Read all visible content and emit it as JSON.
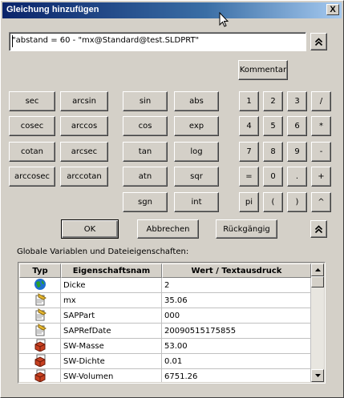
{
  "window": {
    "title": "Gleichung hinzufügen",
    "close_glyph": "X"
  },
  "equation": {
    "value": "\"abstand = 60 - \"mx@Standard@test.SLDPRT\""
  },
  "buttons": {
    "collapse_top": "⌃",
    "kommentar": "Kommentar",
    "ok": "OK",
    "abbrechen": "Abbrechen",
    "rueckgaengig": "Rückgängig",
    "collapse_bottom": "⌃"
  },
  "keypad": {
    "trig": [
      "sec",
      "arcsin",
      "cosec",
      "arccos",
      "cotan",
      "arcsec",
      "arccosec",
      "arccotan"
    ],
    "funcs": [
      "sin",
      "abs",
      "cos",
      "exp",
      "tan",
      "log",
      "atn",
      "sqr",
      "sgn",
      "int"
    ],
    "nums": [
      "1",
      "2",
      "3",
      "/",
      "4",
      "5",
      "6",
      "*",
      "7",
      "8",
      "9",
      "-",
      "=",
      "0",
      ".",
      "+",
      "pi",
      "(",
      ")",
      "^"
    ]
  },
  "globals_label": "Globale Variablen und Dateieigenschaften:",
  "table": {
    "headers": [
      "Typ",
      "Eigenschaftsnam",
      "Wert / Textausdruck"
    ],
    "rows": [
      {
        "icon": "globe-icon",
        "name": "Dicke",
        "value": "2"
      },
      {
        "icon": "property-icon",
        "name": "mx",
        "value": "35.06"
      },
      {
        "icon": "property-icon",
        "name": "SAPPart",
        "value": "000"
      },
      {
        "icon": "property-icon",
        "name": "SAPRefDate",
        "value": "20090515175855"
      },
      {
        "icon": "mass-property-icon",
        "name": "SW-Masse",
        "value": "53.00"
      },
      {
        "icon": "mass-property-icon",
        "name": "SW-Dichte",
        "value": "0.01"
      },
      {
        "icon": "mass-property-icon",
        "name": "SW-Volumen",
        "value": "6751.26"
      }
    ]
  },
  "colors": {
    "titlebar_start": "#0a246a",
    "titlebar_end": "#a6caf0",
    "face": "#d4d0c8"
  }
}
